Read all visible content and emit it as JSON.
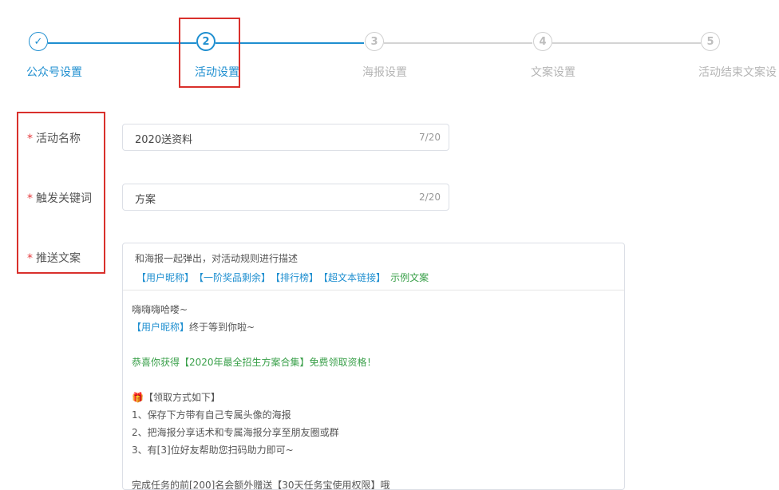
{
  "steps": [
    {
      "number": "✓",
      "label": "公众号设置"
    },
    {
      "number": "2",
      "label": "活动设置"
    },
    {
      "number": "3",
      "label": "海报设置"
    },
    {
      "number": "4",
      "label": "文案设置"
    },
    {
      "number": "5",
      "label": "活动结束文案设"
    }
  ],
  "form": {
    "required_mark": "*",
    "activity_name": {
      "label": "活动名称",
      "value": "2020送资料",
      "count": "7/20"
    },
    "keyword": {
      "label": "触发关键词",
      "value": "方案",
      "count": "2/20"
    },
    "push_text": {
      "label": "推送文案",
      "hint": "和海报一起弹出，对活动规则进行描述",
      "tags": [
        "【用户昵称】",
        "【一阶奖品剩余】",
        "【排行榜】",
        "【超文本链接】"
      ],
      "example": "示例文案",
      "content": {
        "l1": "嗨嗨嗨哈喽~",
        "l2_tag": "【用户昵称】",
        "l2_text": "终于等到你啦~",
        "l3": "恭喜你获得【2020年最全招生方案合集】免费领取资格！",
        "l4": "🎁【领取方式如下】",
        "l5": "1、保存下方带有自己专属头像的海报",
        "l6": "2、把海报分享话术和专属海报分享至朋友圈或群",
        "l7": "3、有[3]位好友帮助您扫码助力即可~",
        "l8": "完成任务的前[200]名会额外赠送【30天任务宝使用权限】哦"
      }
    }
  },
  "colors": {
    "accent": "#1f8fd0",
    "highlight_box": "#d9302c",
    "required": "#e4393c",
    "example": "#3aa04a"
  }
}
